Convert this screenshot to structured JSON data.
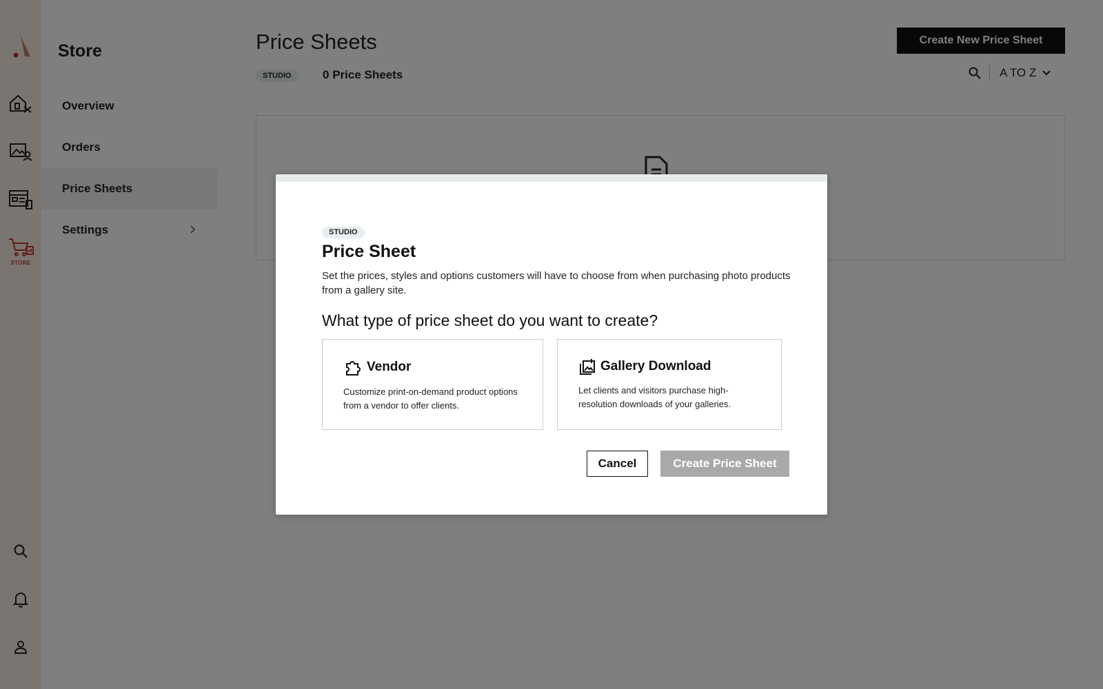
{
  "rail": {
    "store_label": "STORE",
    "accent": "#c0392b"
  },
  "sidebar": {
    "title": "Store",
    "items": [
      {
        "label": "Overview"
      },
      {
        "label": "Orders"
      },
      {
        "label": "Price Sheets"
      },
      {
        "label": "Settings"
      }
    ]
  },
  "main": {
    "title": "Price Sheets",
    "create_button": "Create New Price Sheet",
    "chip": "STUDIO",
    "count_number": "0",
    "count_label": "Price Sheets",
    "sort_label": "A TO Z"
  },
  "modal": {
    "chip": "STUDIO",
    "title": "Price Sheet",
    "description": "Set the prices, styles and options customers will have to choose from when purchasing photo products from a gallery site.",
    "question": "What type of price sheet do you want to create?",
    "options": [
      {
        "title": "Vendor",
        "description": "Customize print-on-demand product options from a vendor to offer clients.",
        "icon": "puzzle-icon"
      },
      {
        "title": "Gallery Download",
        "description": "Let clients and visitors purchase high-resolution downloads of your galleries.",
        "icon": "gallery-download-icon"
      }
    ],
    "cancel_label": "Cancel",
    "create_label": "Create Price Sheet"
  }
}
